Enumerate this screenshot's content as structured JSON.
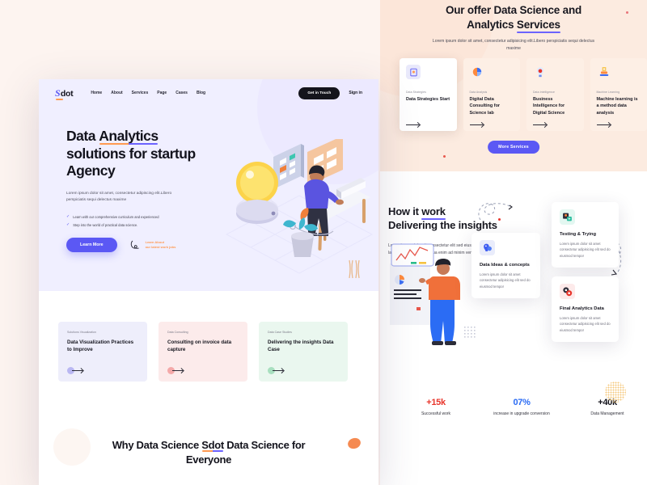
{
  "front": {
    "nav": {
      "logo": "Sdot",
      "logo_initial": "S",
      "links": [
        "Home",
        "About",
        "Services",
        "Page",
        "Cases",
        "Blog"
      ],
      "cta_label": "Get in Touch",
      "signin_label": "Sign in"
    },
    "hero": {
      "title_line1_a": "Data ",
      "title_line1_b": "Analytics",
      "title_line2": "solutions for startup",
      "title_line3": "Agency",
      "paragraph": "Lorem ipsum dolor sit amet, consectetur adipiscing elit.Libero perspiciatis sequi delectus maxime",
      "bullets": [
        "Learn with our comprehensive curriculum and experienced",
        "Step into the world of practical data science."
      ],
      "primary_button": "Learn More",
      "secondary_label_line1": "Learn About",
      "secondary_label_line2": "our latest work jobs"
    },
    "cards": [
      {
        "kicker": "Solutions Visualization",
        "title": "Data Visualization Practices to Improve",
        "bg": "#eeeefb",
        "dot": "#b9b7f2"
      },
      {
        "kicker": "Data Consulting",
        "title": "Consulting on invoice data capture",
        "bg": "#fcebeb",
        "dot": "#f4a9a9"
      },
      {
        "kicker": "Data Case Studies",
        "title": "Delivering the insights Data Case",
        "bg": "#eaf7ef",
        "dot": "#a8dfbf"
      }
    ],
    "bottom": {
      "title_a": "Why Data Science ",
      "title_b": "Sdot",
      "title_c": " Data Science for Everyone"
    }
  },
  "back": {
    "hero": {
      "title_line1": "Our offer Data Science and",
      "title_line2_a": "Analytics ",
      "title_line2_b": "Services",
      "subtitle": "Lorem ipsum dolor sit amet, consectetur adipisicing elit.Libero perspiciatis sequi delectus maxime",
      "more_button": "More Services"
    },
    "services": [
      {
        "kicker": "Data Strategies",
        "title": "Data Strategies Start",
        "icon": "document-icon",
        "ico_bg": "#e9e9fb"
      },
      {
        "kicker": "Data Analysis",
        "title": "Digital Data Consulting for Science lab",
        "icon": "pie-chart-icon",
        "ico_bg": "#fdeadf"
      },
      {
        "kicker": "Data Intelligence",
        "title": "Business Intelligence for Digital Science",
        "icon": "bulb-gear-icon",
        "ico_bg": "#fdeadf"
      },
      {
        "kicker": "Machine Learning",
        "title": "Machine learning is a method data analysis",
        "icon": "stamp-icon",
        "ico_bg": "#fdeadf"
      }
    ],
    "mid": {
      "title_line1_a": "How it ",
      "title_line1_b": "work",
      "title_line2": "Delivering the insights",
      "paragraph": "Lorem ipsum dolor sit consectetur elit sed eiusmod tempor incididunt labore dolore magna aliqua enim ad minim veniam"
    },
    "float_cards": [
      {
        "title": "Data Ideas & concepts",
        "text": "Lorem ipsum dolor sit amet consectetur adipisicing elit sed do eiusmod tempor",
        "icon": "brain-idea-icon",
        "ico_bg": "#e9ecfb"
      },
      {
        "title": "Testing & Trying",
        "text": "Lorem ipsum dolor sit amet consectetur adipisicing elit sed do eiusmod tempor",
        "icon": "test-tube-icon",
        "ico_bg": "#e3f7f1"
      },
      {
        "title": "Final Analytics Data",
        "text": "Lorem ipsum dolor sit amet consectetur adipisicing elit sed do eiusmod tempor",
        "icon": "analytics-gear-icon",
        "ico_bg": "#fdeaea"
      }
    ],
    "stats": [
      {
        "value": "+15k",
        "label": "Successful work",
        "color": "#e8352b"
      },
      {
        "value": "07%",
        "label": "increase in upgrade conversion",
        "color": "#2b6cf4"
      },
      {
        "value": "+40k",
        "label": "Data Management",
        "color": "#14141c"
      }
    ]
  },
  "theme": {
    "accent_purple": "#5b58f4",
    "accent_orange": "#ff9a52",
    "hero_bg": "#f0efff",
    "back_hero_bg": "#fcebe0",
    "page_bg": "#fdf4f0"
  }
}
